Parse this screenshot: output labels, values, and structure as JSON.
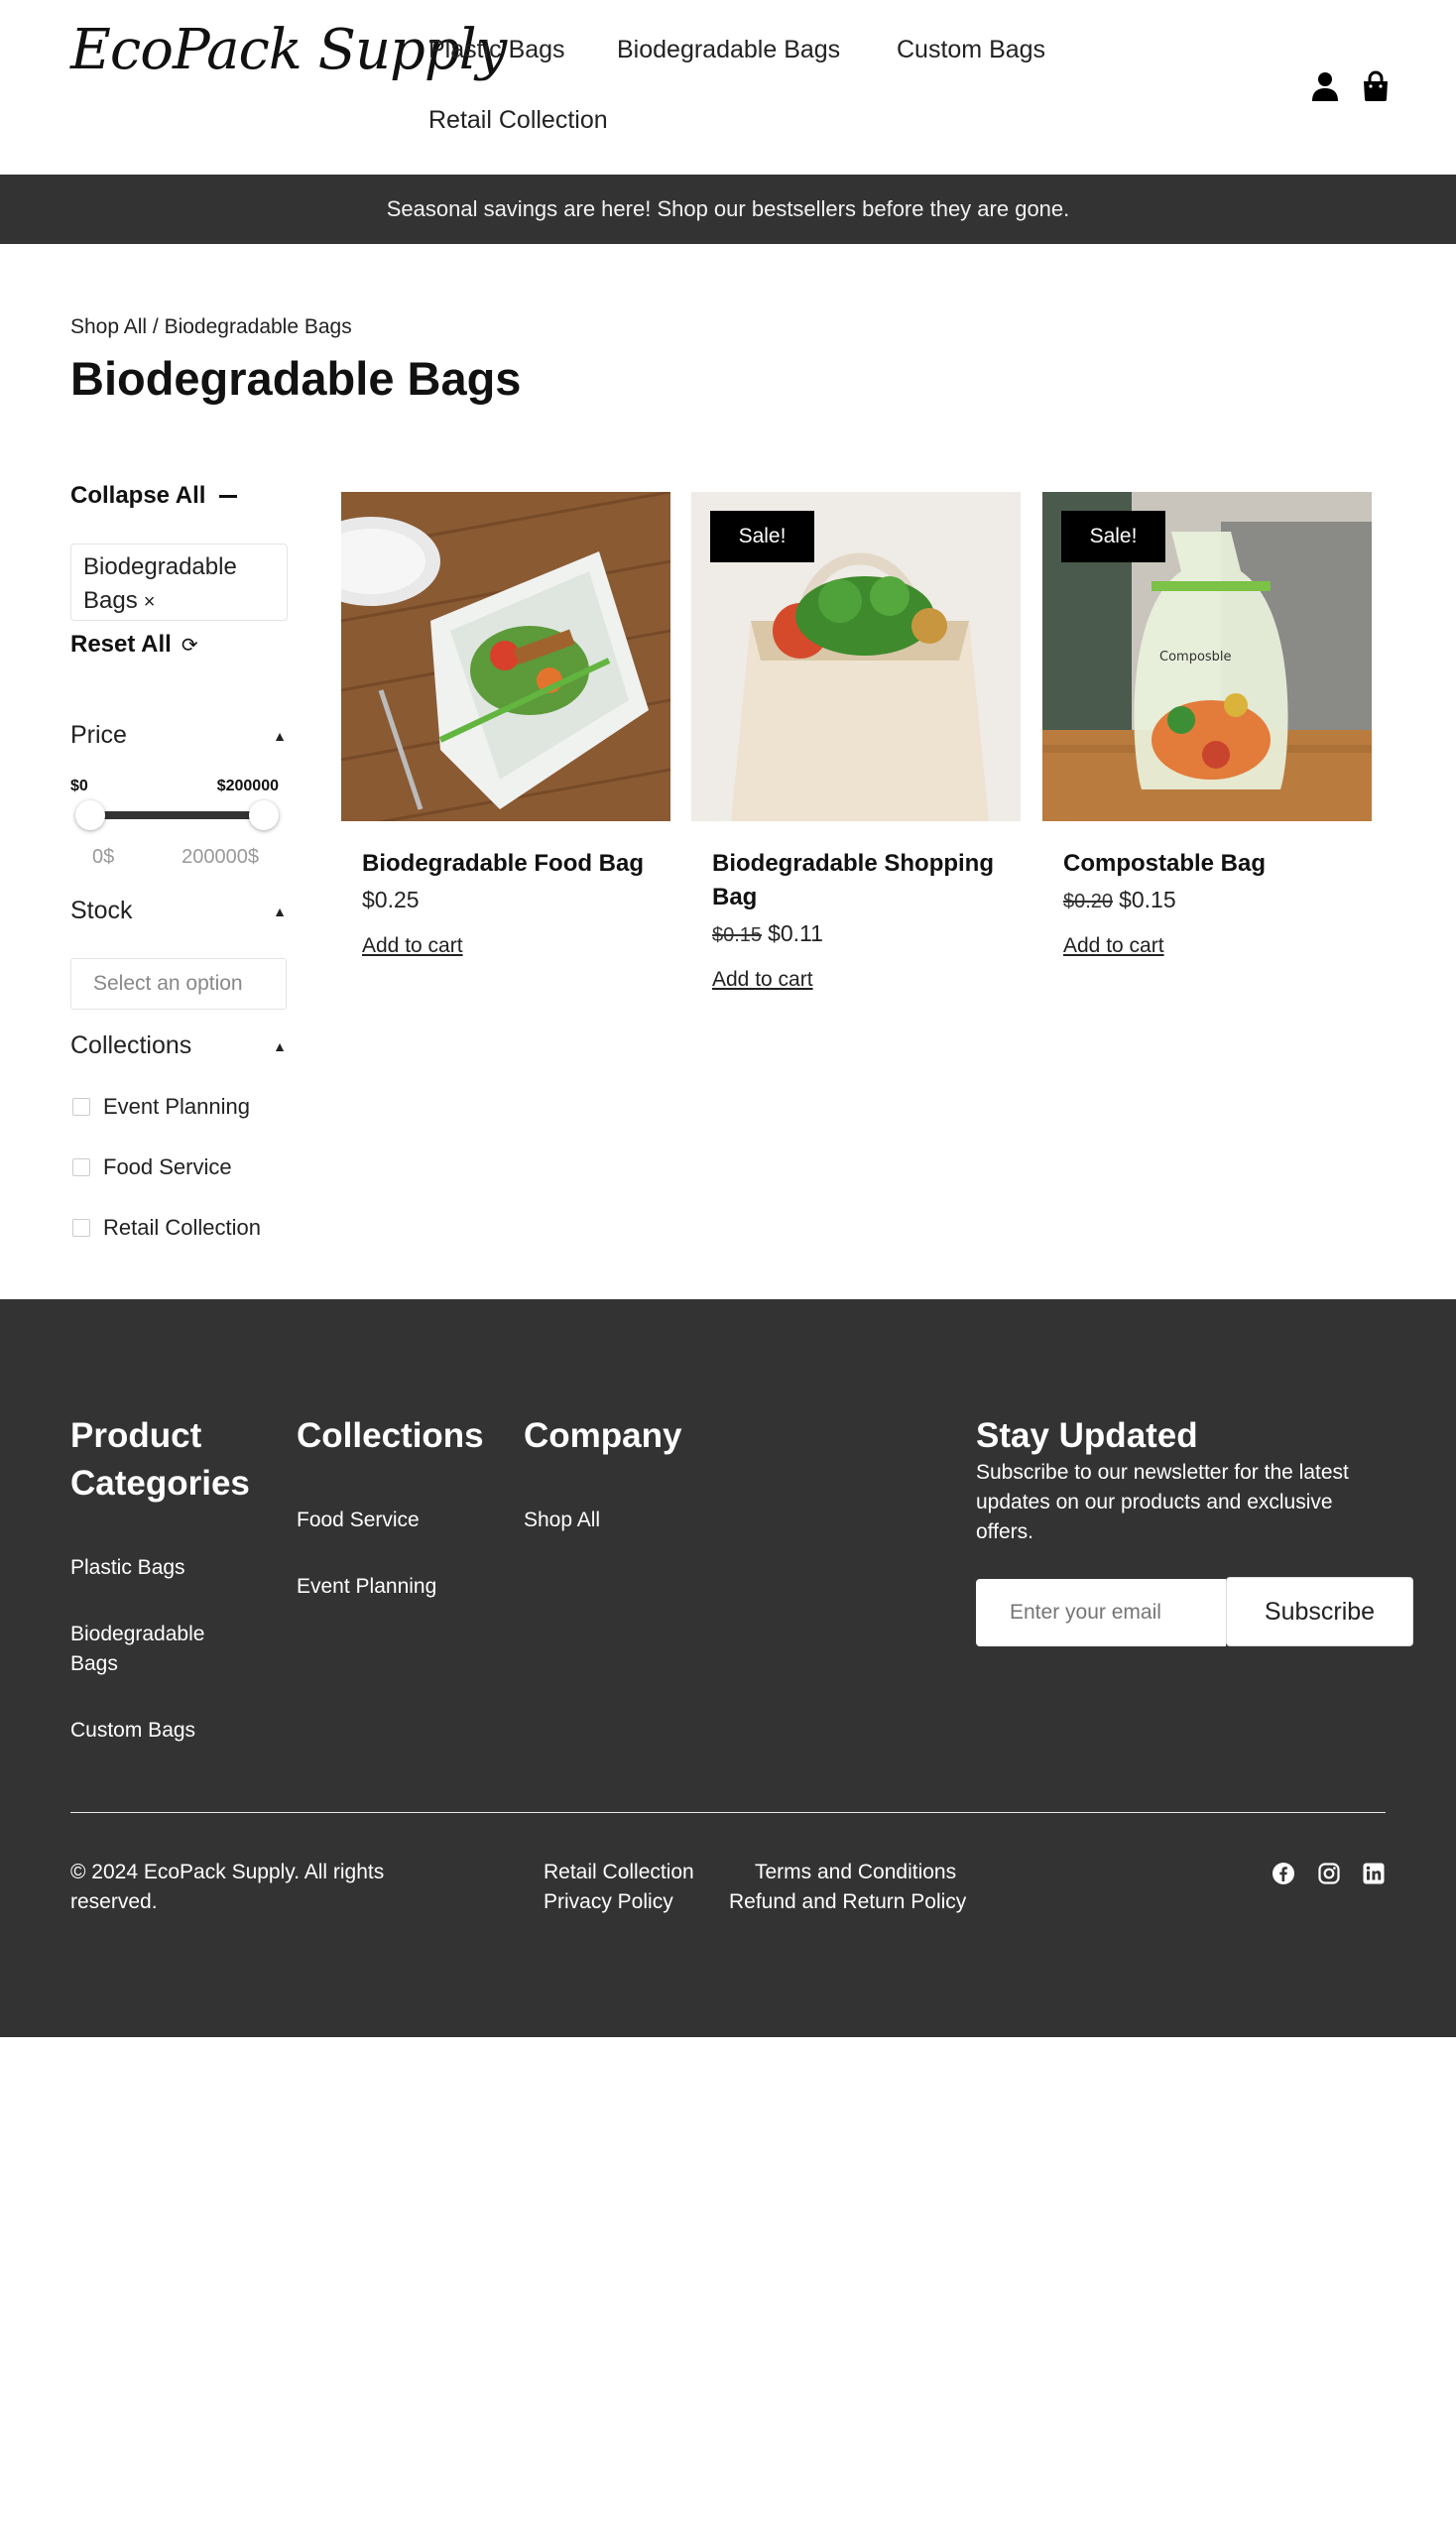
{
  "header": {
    "logo": "EcoPack Supply",
    "nav": [
      {
        "label": "Plastic Bags"
      },
      {
        "label": "Biodegradable Bags"
      },
      {
        "label": "Custom Bags"
      },
      {
        "label": "Retail Collection"
      }
    ],
    "icons": [
      "user-icon",
      "shopping-bag-icon"
    ]
  },
  "announcement": "Seasonal savings are here! Shop our bestsellers before they are gone.",
  "breadcrumb": {
    "parent": "Shop All",
    "separator": " / ",
    "current": "Biodegradable Bags"
  },
  "page_title": "Biodegradable Bags",
  "filters": {
    "collapse_all": "Collapse All",
    "active_chip": "Biodegradable Bags",
    "chip_remove": "×",
    "reset_all": "Reset All",
    "price": {
      "label": "Price",
      "min_label": "$0",
      "max_label": "$200000",
      "min_value": "0$",
      "max_value": "200000$"
    },
    "stock": {
      "label": "Stock",
      "placeholder": "Select an option"
    },
    "collections": {
      "label": "Collections",
      "options": [
        "Event Planning",
        "Food Service",
        "Retail Collection"
      ]
    }
  },
  "products": [
    {
      "name": "Biodegradable Food Bag",
      "price": "$0.25",
      "old_price": "",
      "sale": false,
      "badge": "",
      "cta": "Add to cart"
    },
    {
      "name": "Biodegradable Shopping Bag",
      "price": "$0.11",
      "old_price": "$0.15",
      "sale": true,
      "badge": "Sale!",
      "cta": "Add to cart"
    },
    {
      "name": "Compostable Bag",
      "price": "$0.15",
      "old_price": "$0.20",
      "sale": true,
      "badge": "Sale!",
      "cta": "Add to cart"
    }
  ],
  "footer": {
    "categories": {
      "heading": "Product Categories",
      "links": [
        "Plastic Bags",
        "Biodegradable Bags",
        "Custom Bags"
      ]
    },
    "collections": {
      "heading": "Collections",
      "links": [
        "Food Service",
        "Event Planning"
      ]
    },
    "company": {
      "heading": "Company",
      "links": [
        "Shop All"
      ]
    },
    "newsletter": {
      "heading": "Stay Updated",
      "text": "Subscribe to our newsletter for the latest updates on our products and exclusive offers.",
      "placeholder": "Enter your email",
      "button": "Subscribe"
    },
    "copyright": "© 2024 EcoPack Supply. All rights reserved.",
    "bottom_links": [
      "Retail Collection",
      "Terms and Conditions",
      "Privacy Policy",
      "Refund and Return Policy"
    ],
    "social_icons": [
      "facebook-icon",
      "instagram-icon",
      "linkedin-icon"
    ]
  },
  "colors": {
    "dark": "#333333",
    "text": "#111111",
    "border": "#e4e4e4"
  }
}
